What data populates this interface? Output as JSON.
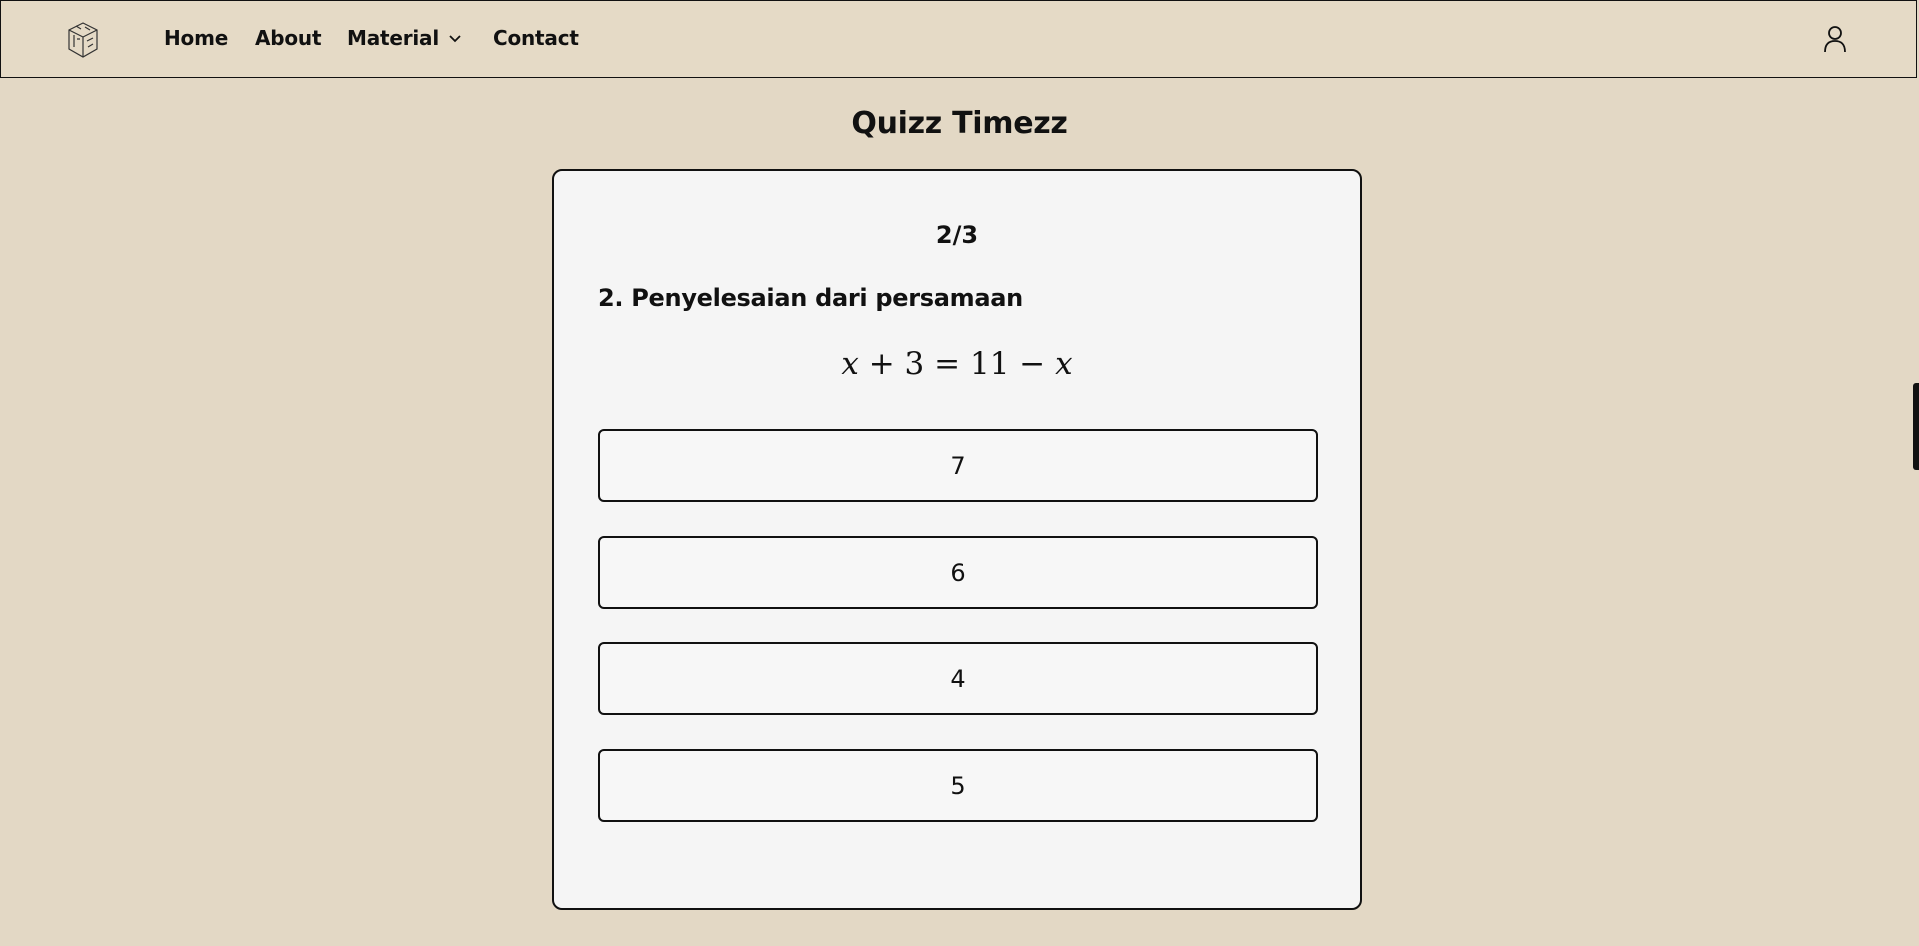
{
  "nav": {
    "items": [
      {
        "label": "Home"
      },
      {
        "label": "About"
      },
      {
        "label": "Material"
      },
      {
        "label": "Contact"
      }
    ]
  },
  "page": {
    "title": "Quizz Timezz"
  },
  "quiz": {
    "progress": "2/3",
    "question": "2. Penyelesaian dari persamaan",
    "equation": {
      "var": "x",
      "plus": "+",
      "const_left": "3",
      "equals": "=",
      "const_right": "11",
      "minus": "−"
    },
    "options": [
      {
        "label": "7"
      },
      {
        "label": "6"
      },
      {
        "label": "4"
      },
      {
        "label": "5"
      }
    ]
  },
  "colors": {
    "background": "#e3d8c5",
    "card": "#f5f5f5",
    "border": "#111111"
  }
}
